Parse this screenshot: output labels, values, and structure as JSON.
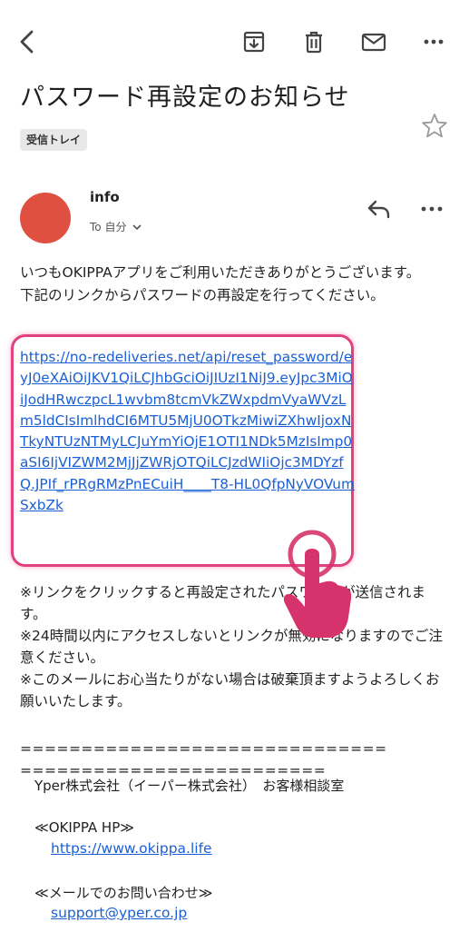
{
  "toolbar": {
    "back_icon": "chevron-left-icon",
    "archive_icon": "archive-icon",
    "delete_icon": "trash-icon",
    "mail_icon": "envelope-icon",
    "more_icon": "more-horizontal-icon"
  },
  "email": {
    "subject": "パスワード再設定のお知らせ",
    "label": "受信トレイ",
    "sender": "info",
    "recipient": "To 自分",
    "avatar_color": "#df5040"
  },
  "body": {
    "greeting": "いつもOKIPPAアプリをご利用いただきありがとうございます。",
    "instruction": "下記のリンクからパスワードの再設定を行ってください。",
    "reset_link": "https://no-redeliveries.net/api/reset_password/eyJ0eXAiOiJKV1QiLCJhbGciOiJIUzI1NiJ9.eyJpc3MiOiJodHRwczpcL1wvbm8tcmVkZWxpdmVyaWVzLm5ldCIsImlhdCI6MTU5MjU0OTkzMiwiZXhwIjoxNTkyNTUzNTMyLCJuYmYiOjE1OTI1NDk5MzIsImp0aSI6IjVIZWM2MjJjZWRjOTQiLCJzdWIiOjc3MDYzfQ.JPIf_rPRgRMzPnECuiH____T8-HL0QfpNyVOVumSxbZk",
    "note1": "※リンクをクリックすると再設定されたパスワードが送信されます。",
    "note2": "※24時間以内にアクセスしないとリンクが無効になりますのでご注意ください。",
    "note3": "※このメールにお心当たりがない場合は破棄頂ますようよろしくお願いいたします。",
    "separator1": "==============================",
    "separator2": "=========================",
    "company": "Yper株式会社（イーパー株式会社）　お客様相談室",
    "hp_label": "≪OKIPPA HP≫",
    "hp_link": "https://www.okippa.life",
    "mail_label": "≪メールでのお問い合わせ≫",
    "mail_link": "support@yper.co.jp"
  },
  "colors": {
    "link": "#1a5fd6",
    "highlight": "#e0417f",
    "hand": "#d6336c"
  }
}
